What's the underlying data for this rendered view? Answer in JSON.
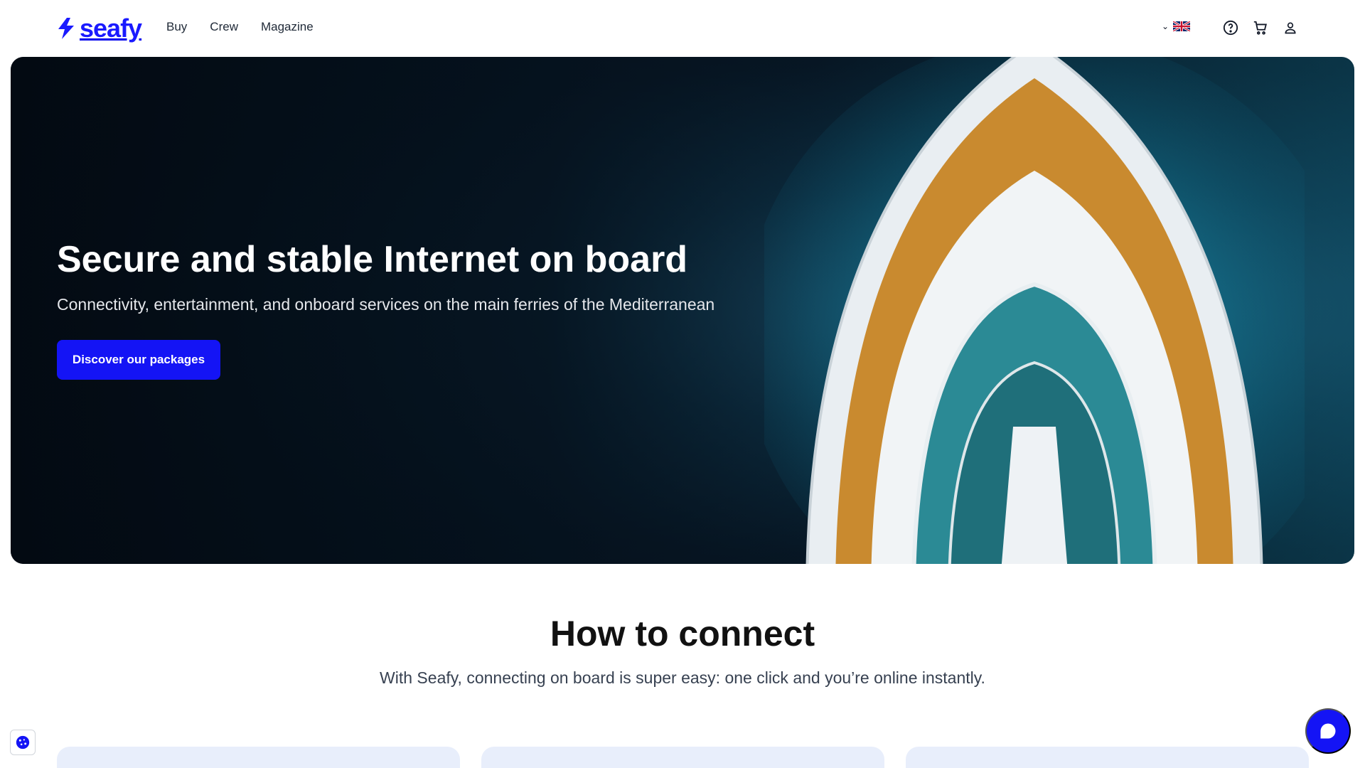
{
  "brand": {
    "name": "seafy",
    "color": "#1a1aff"
  },
  "nav": {
    "items": [
      {
        "label": "Buy"
      },
      {
        "label": "Crew"
      },
      {
        "label": "Magazine"
      }
    ]
  },
  "language": {
    "selected": "English",
    "icon": "uk-flag-icon"
  },
  "header_actions": {
    "help": "help-icon",
    "cart": "cart-icon",
    "account": "user-icon"
  },
  "hero": {
    "title": "Secure and stable Internet on board",
    "subtitle": "Connectivity, entertainment, and onboard services on the main ferries of the Mediterranean",
    "cta_label": "Discover our packages"
  },
  "section": {
    "title": "How to connect",
    "subtitle": "With Seafy, connecting on board is super easy: one click and you’re online instantly."
  },
  "colors": {
    "accent": "#1414f5",
    "card_bg": "#e8eefb"
  }
}
